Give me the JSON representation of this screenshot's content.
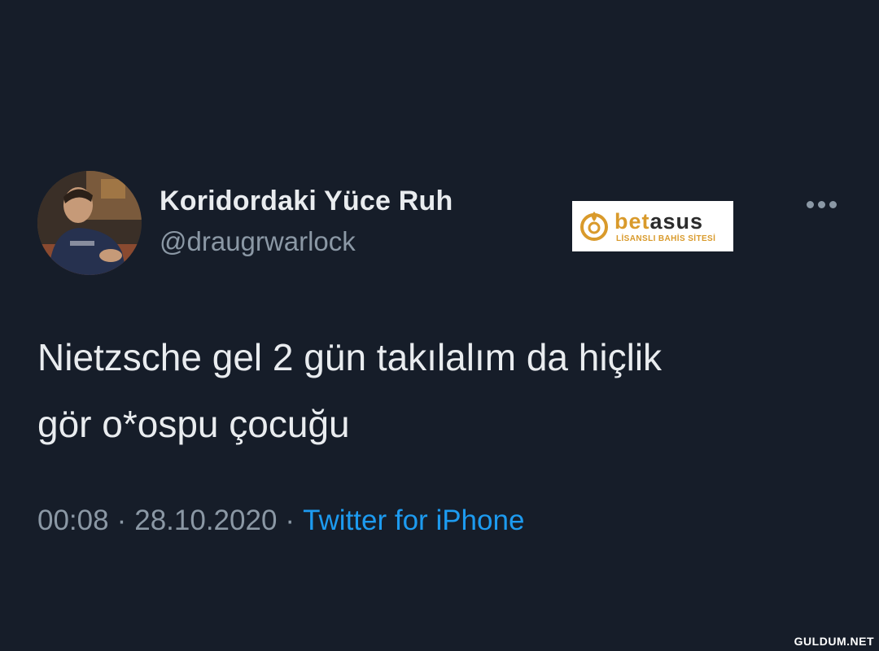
{
  "user": {
    "display_name": "Koridordaki Yüce Ruh",
    "handle": "@draugrwarlock"
  },
  "ad": {
    "brand_prefix": "bet",
    "brand_suffix": "asus",
    "tagline": "LİSANSLI BAHİS SİTESİ"
  },
  "tweet": {
    "lines": [
      "Nietzsche gel 2 gün takılalım da hiçlik",
      "gör o*ospu çocuğu"
    ],
    "time": "00:08",
    "separator": "·",
    "date": "28.10.2020",
    "source": "Twitter for iPhone"
  },
  "watermark": "GULDUM.NET",
  "icons": {
    "more": "more-horizontal-icon"
  },
  "colors": {
    "background": "#161d29",
    "primary_text": "#e9ecef",
    "secondary_text": "#8b98a5",
    "link": "#1d9bf0",
    "ad_gold": "#d99a2b"
  }
}
